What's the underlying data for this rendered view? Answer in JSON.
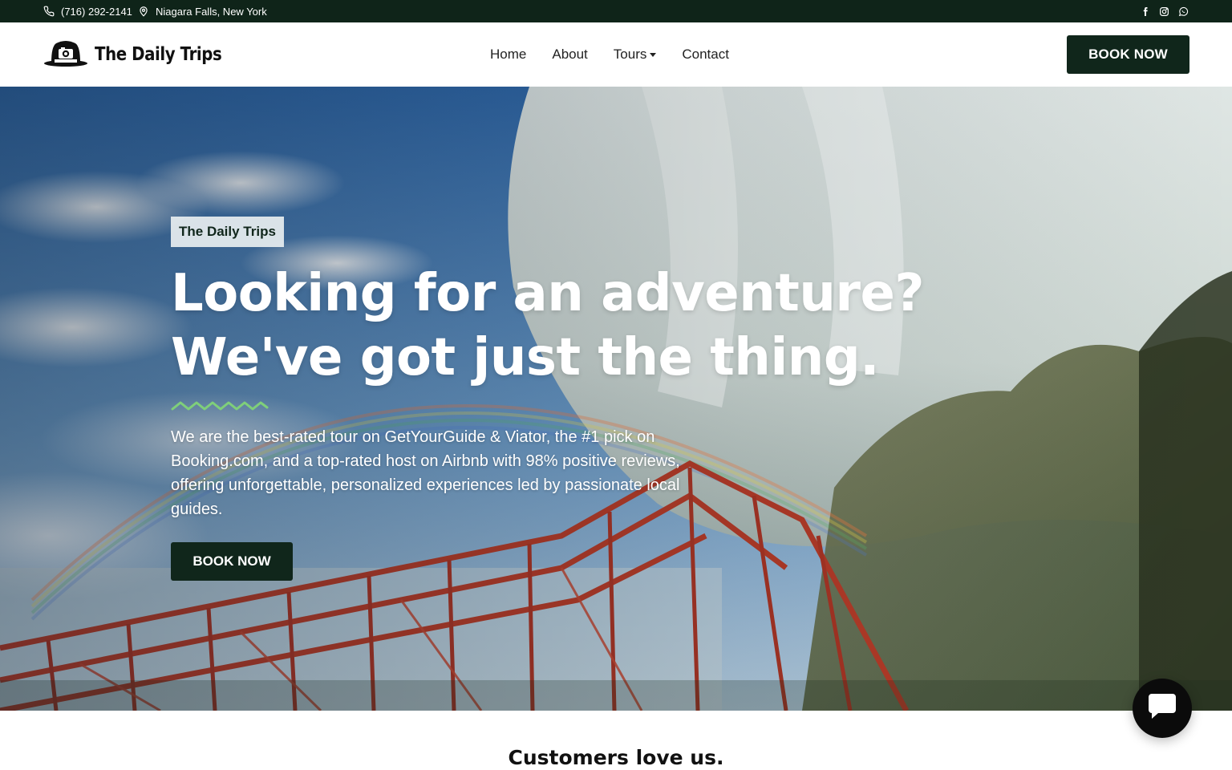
{
  "topbar": {
    "phone": "(716) 292-2141",
    "location": "Niagara Falls, New York",
    "phone_icon": "phone-icon",
    "location_icon": "map-pin-icon",
    "socials": [
      "facebook-icon",
      "instagram-icon",
      "whatsapp-icon"
    ]
  },
  "header": {
    "logo_text": "The Daily Trips",
    "logo_icon": "hat-camera-icon",
    "nav": [
      {
        "label": "Home"
      },
      {
        "label": "About"
      },
      {
        "label": "Tours",
        "has_dropdown": true
      },
      {
        "label": "Contact"
      }
    ],
    "book_label": "BOOK NOW"
  },
  "hero": {
    "badge": "The Daily Trips",
    "title_line1": "Looking for an adventure?",
    "title_line2": "We've got just the thing.",
    "description": "We are the best-rated tour on GetYourGuide & Viator, the #1 pick on Booking.com, and a top-rated host on Airbnb with 98% positive reviews, offering unforgettable, personalized experiences led by passionate local guides.",
    "cta_label": "BOOK NOW"
  },
  "section": {
    "title": "Customers love us."
  },
  "chat": {
    "icon": "chat-bubble-icon"
  },
  "colors": {
    "topbar_bg": "#0f2419",
    "button_bg": "#10261b",
    "accent_green": "#7fcf7a"
  }
}
